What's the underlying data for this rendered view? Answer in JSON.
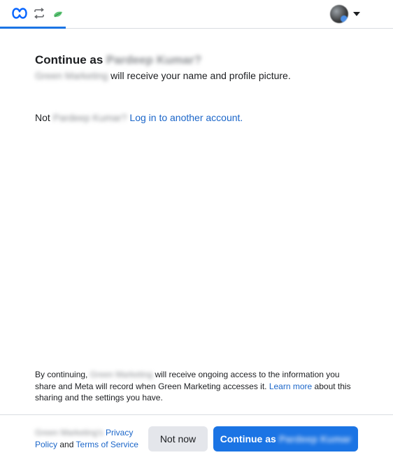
{
  "header": {
    "meta_logo_icon": "meta-infinity-logo",
    "swap_icon": "swap-arrows-icon",
    "app_icon": "app-leaf-icon",
    "account_avatar": "user-avatar",
    "menu_icon": "caret-down-icon"
  },
  "main": {
    "headline_prefix": "Continue as",
    "user_name": "Pardeep Kumar?",
    "app_name": "Green Marketing",
    "subline_suffix": "will receive your name and profile picture.",
    "not_prefix": "Not",
    "not_user_name": "Pardeep Kumar?",
    "switch_account_link": "Log in to another account."
  },
  "disclaimer": {
    "prefix": "By continuing,",
    "app_name": "Green Marketing",
    "middle": "will receive ongoing access to the information you share and Meta will record when Green Marketing accesses it.",
    "learn_more": "Learn more",
    "suffix": "about this sharing and the settings you have."
  },
  "footer": {
    "app_name": "Green Marketing's",
    "privacy_policy": "Privacy Policy",
    "and": "and",
    "terms": "Terms of Service",
    "not_now": "Not now",
    "continue_prefix": "Continue as",
    "continue_name": "Pardeep Kumar"
  },
  "colors": {
    "primary": "#1b74e4",
    "link": "#1b66c9",
    "secondary_button": "#e4e6eb",
    "divider": "#dadde1",
    "app_icon": "#45bd62"
  }
}
